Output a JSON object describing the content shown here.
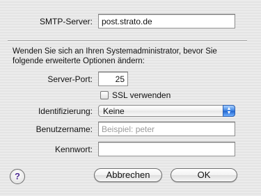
{
  "smtp": {
    "label": "SMTP-Server:",
    "value": "post.strato.de"
  },
  "note": "Wenden Sie sich an Ihren Systemadministrator, bevor Sie folgende erweiterte Optionen ändern:",
  "port": {
    "label": "Server-Port:",
    "value": "25"
  },
  "ssl": {
    "label": "SSL verwenden",
    "checked": false
  },
  "auth": {
    "label": "Identifizierung:",
    "value": "Keine"
  },
  "user": {
    "label": "Benutzername:",
    "placeholder": "Beispiel: peter",
    "value": ""
  },
  "password": {
    "label": "Kennwort:",
    "value": ""
  },
  "buttons": {
    "help": "?",
    "cancel": "Abbrechen",
    "ok": "OK"
  },
  "colors": {
    "accent": "#2f74d8",
    "help": "#4d2a93"
  }
}
